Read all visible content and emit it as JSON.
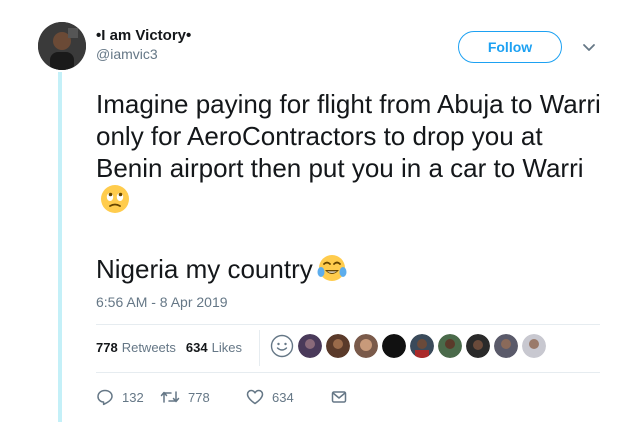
{
  "author": {
    "display_name": "•I am Victory•",
    "handle": "@iamvic3"
  },
  "follow_label": "Follow",
  "tweet": {
    "line1": "Imagine paying for flight from Abuja to Warri only for AeroContractors to drop you at Benin airport then put you in a car to Warri",
    "line2": "Nigeria my country",
    "emoji1": "face-with-rolling-eyes-emoji",
    "emoji2": "face-with-tears-of-joy-emoji"
  },
  "timestamp": "6:56 AM - 8 Apr 2019",
  "stats": {
    "retweets_count": "778",
    "retweets_label": "Retweets",
    "likes_count": "634",
    "likes_label": "Likes"
  },
  "actions": {
    "reply_count": "132",
    "retweet_count": "778",
    "like_count": "634"
  },
  "colors": {
    "accent": "#1da1f2",
    "thread_line": "#c4f0f8",
    "muted_text": "#657786",
    "like_heart": "#e0245e"
  }
}
